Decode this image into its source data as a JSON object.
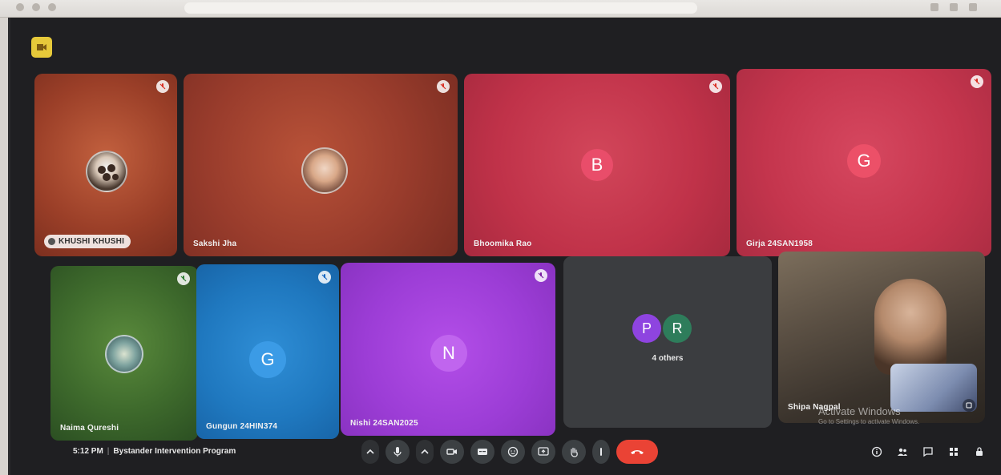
{
  "participants": [
    {
      "name": "KHUSHI KHUSHI",
      "type": "photo"
    },
    {
      "name": "Sakshi Jha",
      "type": "photo"
    },
    {
      "name": "Bhoomika Rao",
      "initial": "B",
      "type": "initial"
    },
    {
      "name": "Girja 24SAN1958",
      "initial": "G",
      "type": "initial"
    },
    {
      "name": "Naima Qureshi",
      "type": "photo"
    },
    {
      "name": "Gungun 24HIN374",
      "initial": "G",
      "type": "initial"
    },
    {
      "name": "Nishi 24SAN2025",
      "initial": "N",
      "type": "initial"
    },
    {
      "others_initials": [
        "P",
        "R"
      ],
      "others_label": "4 others",
      "type": "group"
    },
    {
      "name": "Shipa Nagpal",
      "type": "video"
    }
  ],
  "footer": {
    "time": "5:12 PM",
    "meeting_name": "Bystander Intervention Program"
  },
  "watermark": {
    "title": "Activate Windows",
    "subtitle": "Go to Settings to activate Windows."
  },
  "colors": {
    "bg": "#1f1f22",
    "end_call": "#ea4335",
    "control": "#3c4043",
    "logo": "#e6c93a"
  },
  "icons": [
    "meet-logo-icon",
    "mic-off-icon",
    "chevron-up-icon",
    "mic-icon",
    "camera-icon",
    "captions-icon",
    "emoji-icon",
    "present-icon",
    "raise-hand-icon",
    "more-options-icon",
    "end-call-icon",
    "info-icon",
    "people-icon",
    "chat-icon",
    "activities-icon",
    "lock-icon"
  ]
}
